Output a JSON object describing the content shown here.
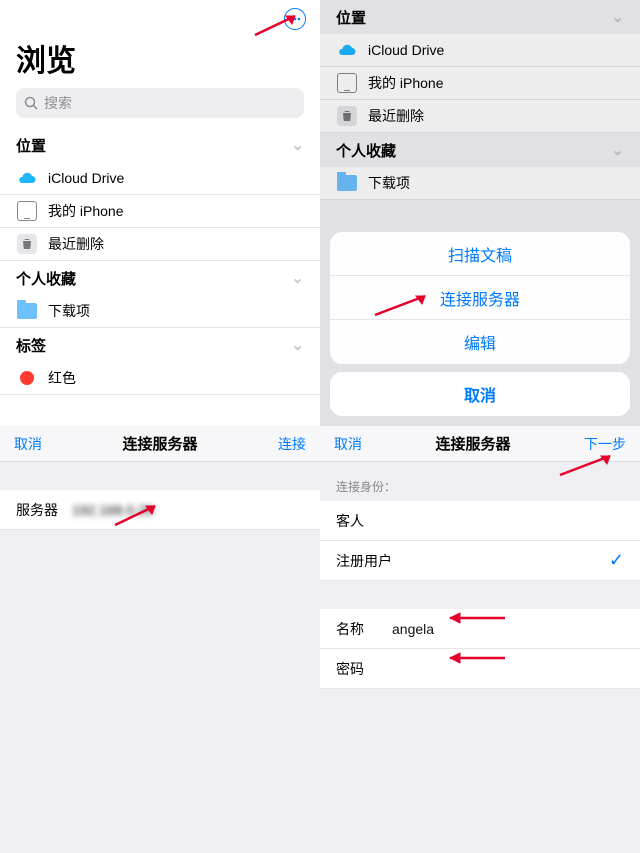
{
  "q1": {
    "title": "浏览",
    "search_placeholder": "搜索",
    "sections": {
      "locations": {
        "header": "位置",
        "items": [
          {
            "label": "iCloud Drive",
            "icon": "cloud"
          },
          {
            "label": "我的 iPhone",
            "icon": "phone"
          },
          {
            "label": "最近删除",
            "icon": "trash"
          }
        ]
      },
      "favorites": {
        "header": "个人收藏",
        "items": [
          {
            "label": "下载项",
            "icon": "folder"
          }
        ]
      },
      "tags": {
        "header": "标签",
        "items": [
          {
            "label": "红色",
            "icon": "dot",
            "color": "#ff3b30"
          }
        ]
      }
    }
  },
  "q2": {
    "sections": {
      "locations": {
        "header": "位置",
        "items": [
          {
            "label": "iCloud Drive",
            "icon": "cloud"
          },
          {
            "label": "我的 iPhone",
            "icon": "phone"
          },
          {
            "label": "最近删除",
            "icon": "trash"
          }
        ]
      },
      "favorites": {
        "header": "个人收藏",
        "items": [
          {
            "label": "下载项",
            "icon": "folder"
          }
        ]
      }
    },
    "sheet": {
      "items": [
        "扫描文稿",
        "连接服务器",
        "编辑"
      ],
      "cancel": "取消"
    }
  },
  "q3": {
    "nav": {
      "left": "取消",
      "title": "连接服务器",
      "right": "连接"
    },
    "server_label": "服务器",
    "server_value": "192.168.0.26"
  },
  "q4": {
    "nav": {
      "left": "取消",
      "title": "连接服务器",
      "right": "下一步"
    },
    "connect_as": "连接身份：",
    "guest": "客人",
    "registered": "注册用户",
    "name_label": "名称",
    "name_value": "angela",
    "password_label": "密码"
  },
  "accent": "#007aff"
}
